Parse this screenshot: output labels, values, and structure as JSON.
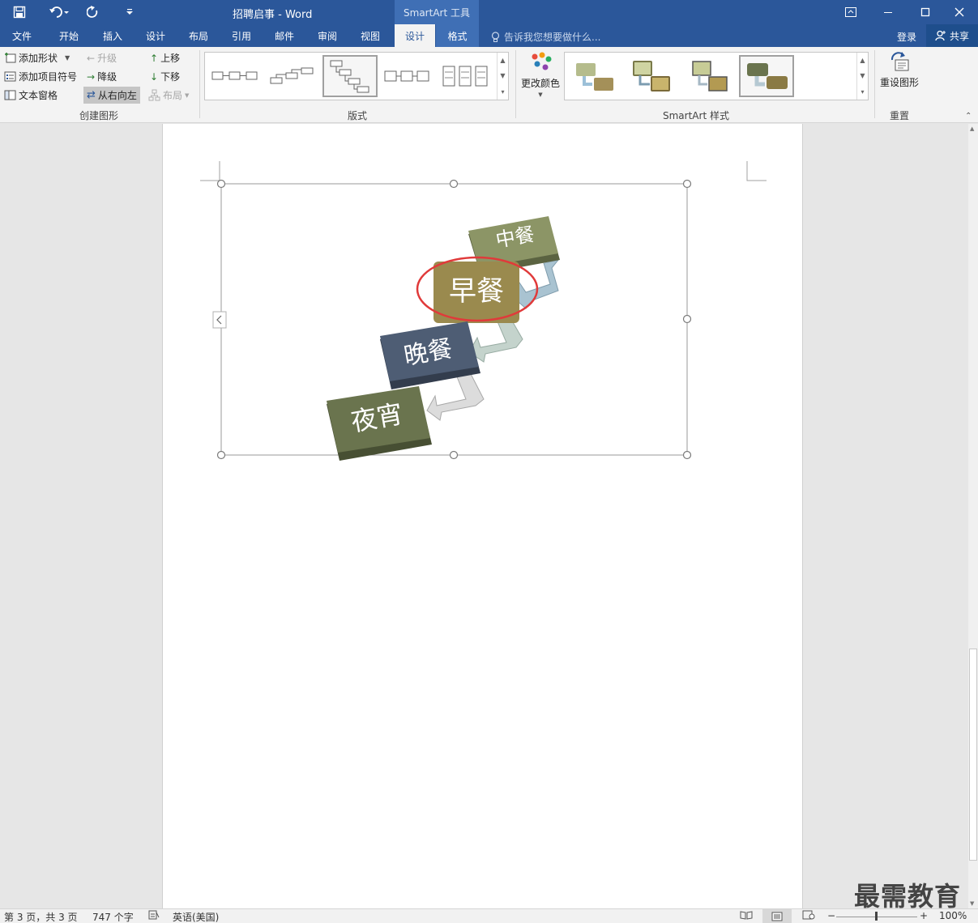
{
  "titlebar": {
    "doc_title": "招聘启事 - Word",
    "tool_title": "SmartArt 工具"
  },
  "tabs": {
    "file": "文件",
    "home": "开始",
    "insert": "插入",
    "design": "设计",
    "layout": "布局",
    "references": "引用",
    "mailings": "邮件",
    "review": "审阅",
    "view": "视图",
    "smartart_design": "设计",
    "smartart_format": "格式",
    "tell_me": "告诉我您想要做什么...",
    "login": "登录",
    "share": "共享"
  },
  "ribbon": {
    "create_graphic": {
      "add_shape": "添加形状",
      "add_bullet": "添加项目符号",
      "text_pane": "文本窗格",
      "promote": "升级",
      "demote": "降级",
      "right_to_left": "从右向左",
      "move_up": "上移",
      "move_down": "下移",
      "layout": "布局",
      "label": "创建图形"
    },
    "layouts": {
      "label": "版式"
    },
    "styles": {
      "change_colors": "更改颜色",
      "label": "SmartArt 样式"
    },
    "reset": {
      "reset_graphic": "重设图形",
      "label": "重置"
    }
  },
  "smartart": {
    "nodes": [
      "中餐",
      "早餐",
      "晚餐",
      "夜宵"
    ],
    "node_colors": [
      "#8c9566",
      "#9a8a4e",
      "#4e5d74",
      "#6a744e"
    ]
  },
  "watermark": "最需教育",
  "statusbar": {
    "page": "第 3 页，共 3 页",
    "words": "747 个字",
    "language": "英语(美国)",
    "zoom": "100%"
  }
}
